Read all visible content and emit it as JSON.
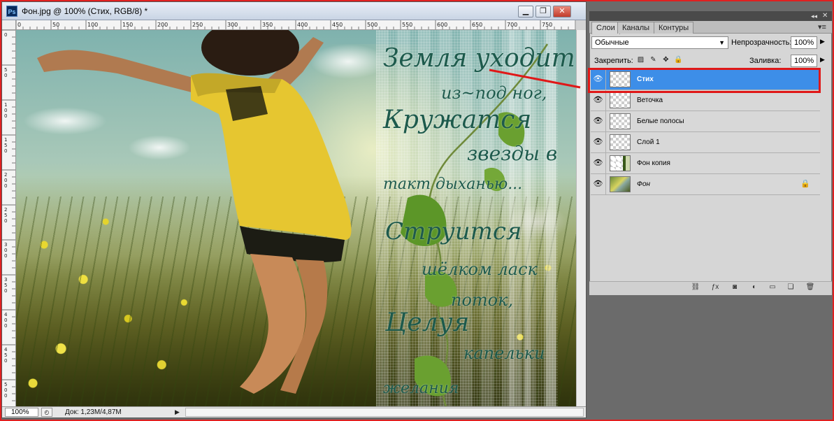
{
  "document": {
    "title": "Фон.jpg @ 100% (Стих, RGB/8) *",
    "app_icon": "Ps",
    "window_buttons": [
      "minimize-icon",
      "restore-icon",
      "close-icon"
    ],
    "ruler_top_ticks": [
      "0",
      "50",
      "100",
      "150",
      "200",
      "250",
      "300",
      "350",
      "400",
      "450",
      "500",
      "550",
      "600",
      "650",
      "700",
      "750"
    ],
    "ruler_left_ticks": [
      "0",
      "5 0",
      "1 0 0",
      "1 5 0",
      "2 0 0",
      "2 5 0",
      "3 0 0",
      "3 5 0",
      "4 0 0",
      "4 5 0",
      "5 0 0"
    ],
    "poem": [
      "Земля уходит",
      "из~под ног,",
      "Кружатся",
      "звезды в",
      "такт дыханью...",
      "Струится",
      "шёлком ласк",
      "поток,",
      "Целуя",
      "капельки",
      "желания"
    ],
    "status": {
      "zoom": "100%",
      "doc_info": "Док: 1,23M/4,87M"
    }
  },
  "layers_panel": {
    "tabs": [
      "Слои",
      "Каналы",
      "Контуры"
    ],
    "active_tab": "Слои",
    "blend_mode": "Обычные",
    "opacity_label": "Непрозрачность:",
    "opacity_value": "100%",
    "lock_label": "Закрепить:",
    "fill_label": "Заливка:",
    "fill_value": "100%",
    "layers": [
      {
        "name": "Стих",
        "selected": true,
        "thumb": "transparent"
      },
      {
        "name": "Веточка",
        "selected": false,
        "thumb": "transparent"
      },
      {
        "name": "Белые полосы",
        "selected": false,
        "thumb": "transparent"
      },
      {
        "name": "Слой 1",
        "selected": false,
        "thumb": "transparent"
      },
      {
        "name": "Фон копия",
        "selected": false,
        "thumb": "copy"
      },
      {
        "name": "Фон",
        "selected": false,
        "thumb": "photo",
        "locked": true
      }
    ],
    "footer_icons": [
      "link-layers-icon",
      "fx-icon",
      "add-mask-icon",
      "adjustment-layer-icon",
      "new-group-icon",
      "new-layer-icon",
      "delete-layer-icon"
    ]
  },
  "colors": {
    "selection": "#3d8ee8",
    "annotation": "#e01818",
    "poem_text": "#1d5a4c"
  }
}
